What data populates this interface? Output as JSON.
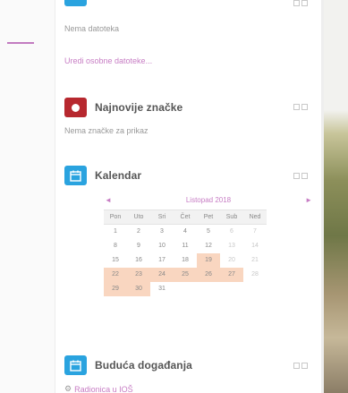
{
  "files_block": {
    "empty_text": "Nema datoteka",
    "edit_link": "Uredi osobne datoteke..."
  },
  "badges_block": {
    "title": "Najnovije značke",
    "empty_text": "Nema značke za prikaz"
  },
  "calendar_block": {
    "title": "Kalendar",
    "prev": "◄",
    "next": "►",
    "month_label": "Listopad 2018",
    "weekdays": [
      "Pon",
      "Uto",
      "Sri",
      "Čet",
      "Pet",
      "Sub",
      "Ned"
    ],
    "weeks": [
      [
        "1",
        "2",
        "3",
        "4",
        "5",
        "6",
        "7"
      ],
      [
        "8",
        "9",
        "10",
        "11",
        "12",
        "13",
        "14"
      ],
      [
        "15",
        "16",
        "17",
        "18",
        "19",
        "20",
        "21"
      ],
      [
        "22",
        "23",
        "24",
        "25",
        "26",
        "27",
        "28"
      ],
      [
        "29",
        "30",
        "31",
        "",
        "",
        "",
        ""
      ]
    ],
    "highlighted_days": [
      "19",
      "20",
      "22",
      "23",
      "24",
      "25",
      "26",
      "27",
      "29",
      "30"
    ]
  },
  "events_block": {
    "title": "Buduća događanja",
    "items": [
      "Radionica u IOŠ"
    ]
  },
  "colors": {
    "link": "#c77dc4",
    "calendar_icon": "#2aa3df",
    "badge_icon": "#b7282f",
    "event_highlight": "#f9d6c0"
  }
}
